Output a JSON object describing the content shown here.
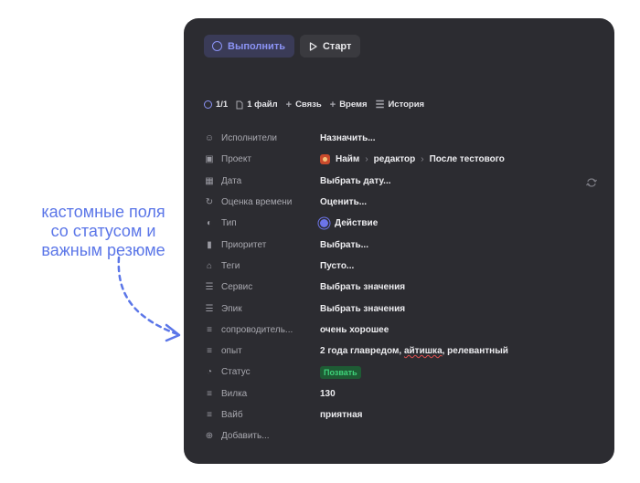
{
  "annotation": {
    "lines": [
      "кастомные поля",
      "со статусом и",
      "важным резюме"
    ],
    "color": "#5b76e8"
  },
  "toolbar": {
    "run_label": "Выполнить",
    "start_label": "Старт"
  },
  "meta": {
    "progress": "1/1",
    "files": "1 файл",
    "link": "Связь",
    "time": "Время",
    "history": "История"
  },
  "fields": {
    "assignees": {
      "label": "Исполнители",
      "value": "Назначить...",
      "icon": "assignee-icon"
    },
    "project": {
      "label": "Проект",
      "path": [
        "Найм",
        "редактор",
        "После тестового"
      ],
      "icon": "project-icon"
    },
    "date": {
      "label": "Дата",
      "value": "Выбрать дату...",
      "icon": "calendar-icon"
    },
    "estimate": {
      "label": "Оценка времени",
      "value": "Оценить...",
      "icon": "clock-icon"
    },
    "type": {
      "label": "Тип",
      "value": "Действие",
      "icon": "type-icon"
    },
    "priority": {
      "label": "Приоритет",
      "value": "Выбрать...",
      "icon": "priority-icon"
    },
    "tags": {
      "label": "Теги",
      "value": "Пусто...",
      "icon": "tag-icon"
    },
    "service": {
      "label": "Сервис",
      "value": "Выбрать значения",
      "icon": "list-icon"
    },
    "epic": {
      "label": "Эпик",
      "value": "Выбрать значения",
      "icon": "list-icon"
    },
    "cover": {
      "label": "сопроводитель...",
      "value": "очень хорошее",
      "icon": "text-icon"
    },
    "experience": {
      "label": "опыт",
      "value_prefix": "2 года главредом, ",
      "value_underlined": "айтишка",
      "value_suffix": ", релевантный",
      "icon": "text-icon"
    },
    "status": {
      "label": "Статус",
      "value": "Позвать",
      "icon": "status-icon",
      "badge_color": "#3fd27a"
    },
    "salary": {
      "label": "Вилка",
      "value": "130",
      "icon": "text-icon"
    },
    "vibe": {
      "label": "Вайб",
      "value": "приятная",
      "icon": "text-icon"
    },
    "add": {
      "label": "Добавить...",
      "icon": "add-circle-icon"
    }
  },
  "colors": {
    "panel": "#2c2c31",
    "accent": "#8b93f5"
  }
}
